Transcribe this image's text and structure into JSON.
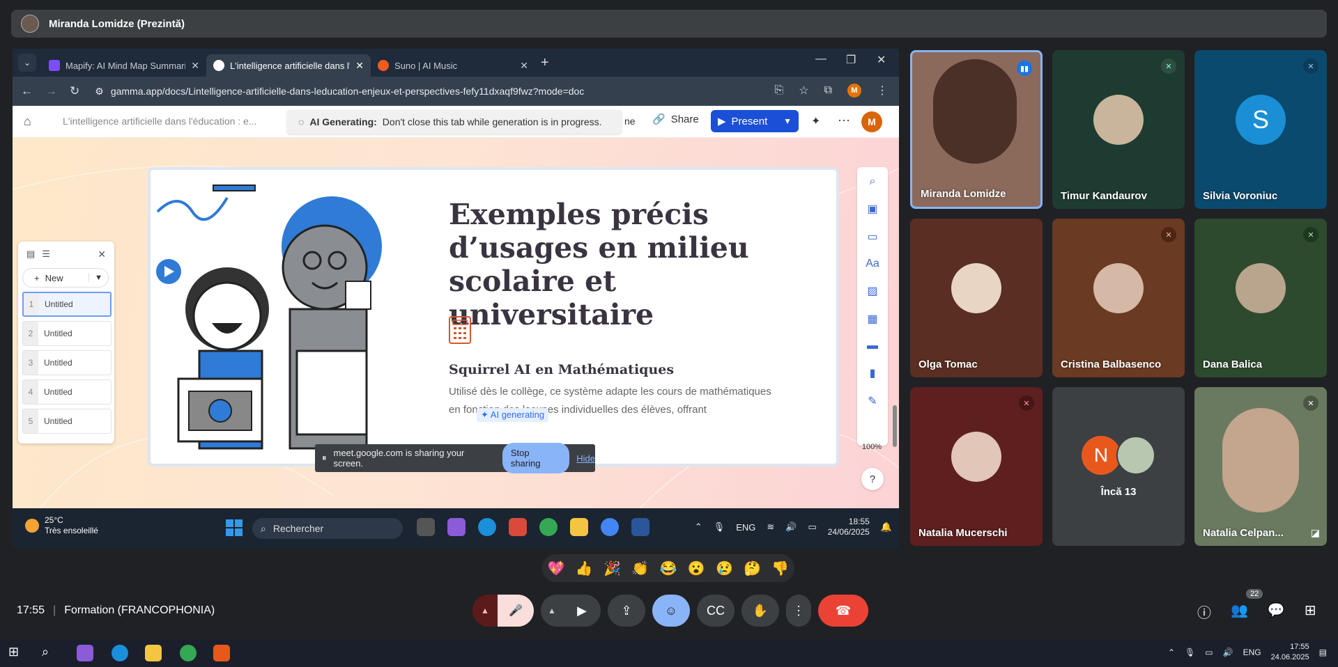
{
  "presenter": {
    "name": "Miranda Lomidze (Prezintă)"
  },
  "browser": {
    "tabs": [
      {
        "title": "Mapify: AI Mind Map Summariz",
        "color": "#7b4dff"
      },
      {
        "title": "L'intelligence artificielle dans l'éd",
        "color": "#ffffff"
      },
      {
        "title": "Suno | AI Music",
        "color": "#f55a1e"
      }
    ],
    "url": "gamma.app/docs/Lintelligence-artificielle-dans-leducation-enjeux-et-perspectives-fefy11dxaqf9fwz?mode=doc",
    "profile_initial": "M"
  },
  "gamma": {
    "breadcrumb": "L'intelligence artificielle dans l'éducation : e...",
    "toast_bold": "AI Generating:",
    "toast_text": "Don't close this tab while generation is in progress.",
    "toast_tail": "ne",
    "share": "Share",
    "present": "Present",
    "user_initial": "M",
    "card": {
      "title": "Exemples précis d’usages en milieu scolaire et universitaire",
      "subtitle": "Squirrel AI en Mathématiques",
      "body": "Utilisé dès le collège, ce système adapte les cours de mathématiques en fonction des lacunes individuelles des élèves, offrant",
      "ai_chip": "AI generating"
    },
    "outline": {
      "new_label": "New",
      "items": [
        {
          "num": "1",
          "label": "Untitled"
        },
        {
          "num": "2",
          "label": "Untitled"
        },
        {
          "num": "3",
          "label": "Untitled"
        },
        {
          "num": "4",
          "label": "Untitled"
        },
        {
          "num": "5",
          "label": "Untitled"
        }
      ]
    },
    "zoom": "100%",
    "help": "?"
  },
  "sharing_banner": {
    "text": "meet.google.com is sharing your screen.",
    "stop": "Stop sharing",
    "hide": "Hide"
  },
  "inner_taskbar": {
    "temp": "25°C",
    "weather": "Très ensoleillé",
    "search": "Rechercher",
    "lang": "ENG",
    "time": "18:55",
    "date": "24/06/2025"
  },
  "participants": [
    {
      "name": "Miranda Lomidze",
      "bg": "#8b6a5c"
    },
    {
      "name": "Timur Kandaurov",
      "bg": "#1e3b31"
    },
    {
      "name": "Silvia Voroniuc",
      "bg": "#0a4a6e",
      "initial": "S"
    },
    {
      "name": "Olga Tomac",
      "bg": "#5a2e22"
    },
    {
      "name": "Cristina Balbasenco",
      "bg": "#6b3a22"
    },
    {
      "name": "Dana Balica",
      "bg": "#2d4a2e"
    },
    {
      "name": "Natalia Mucerschi",
      "bg": "#5e1f1f"
    },
    {
      "name": "Încă 13",
      "bg": "#3c4043",
      "initial": "N"
    },
    {
      "name": "Natalia Celpan...",
      "bg": "#6a7a60"
    }
  ],
  "reactions": [
    "💖",
    "👍",
    "🎉",
    "👏",
    "😂",
    "😮",
    "😢",
    "🤔",
    "👎"
  ],
  "meeting": {
    "time": "17:55",
    "name": "Formation (FRANCOPHONIA)",
    "people_count": "22"
  },
  "host_taskbar": {
    "lang": "ENG",
    "time": "17:55",
    "date": "24.06.2025"
  }
}
